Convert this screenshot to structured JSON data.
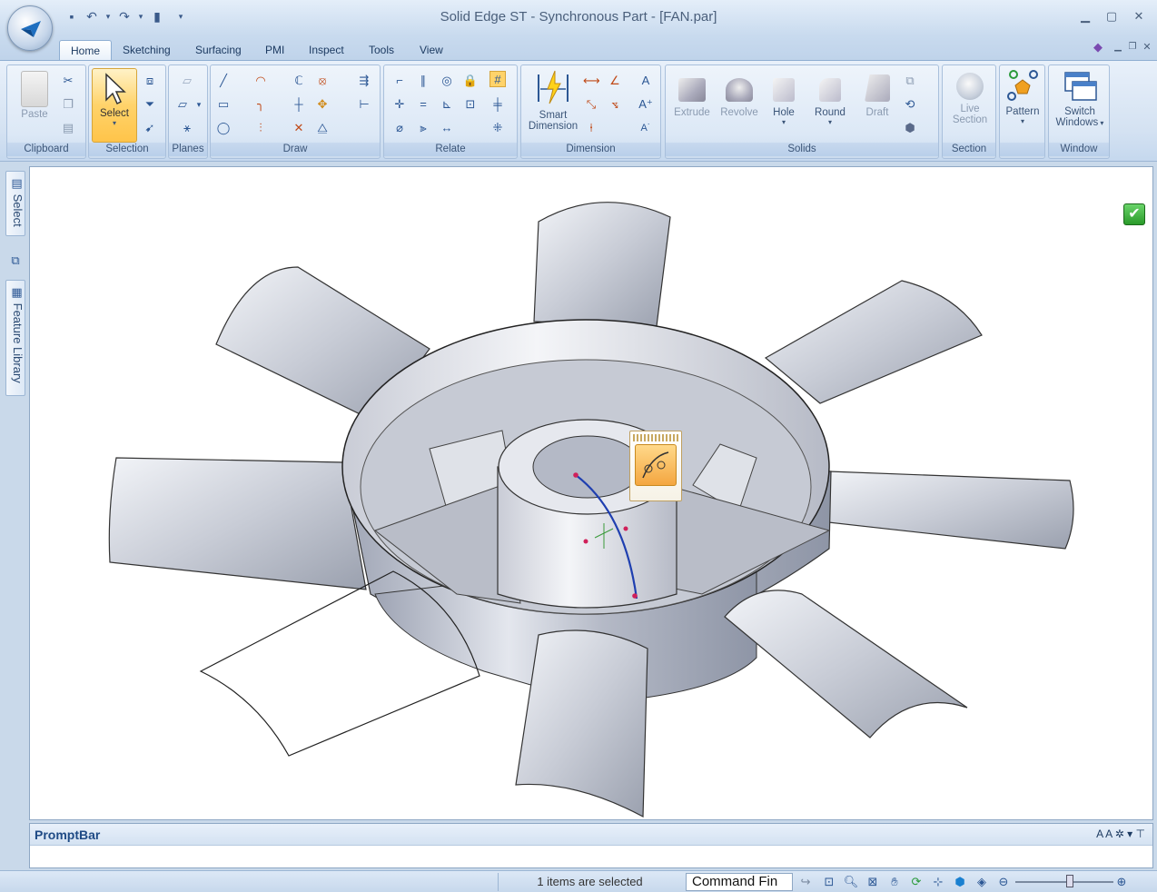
{
  "window": {
    "title": "Solid Edge ST - Synchronous Part - [FAN.par]"
  },
  "tabs": [
    "Home",
    "Sketching",
    "Surfacing",
    "PMI",
    "Inspect",
    "Tools",
    "View"
  ],
  "groups": {
    "clipboard": {
      "label": "Clipboard",
      "paste": "Paste"
    },
    "selection": {
      "label": "Selection",
      "select": "Select"
    },
    "planes": {
      "label": "Planes"
    },
    "draw": {
      "label": "Draw"
    },
    "relate": {
      "label": "Relate"
    },
    "dimension": {
      "label": "Dimension",
      "smart_line1": "Smart",
      "smart_line2": "Dimension"
    },
    "solids": {
      "label": "Solids",
      "extrude": "Extrude",
      "revolve": "Revolve",
      "hole": "Hole",
      "round": "Round",
      "draft": "Draft"
    },
    "section": {
      "label": "Section",
      "live_line1": "Live",
      "live_line2": "Section"
    },
    "pattern": {
      "label": "Pattern"
    },
    "window": {
      "label": "Window",
      "switch_line1": "Switch",
      "switch_line2": "Windows"
    }
  },
  "side_tabs": {
    "select": "Select",
    "feature_library": "Feature Library"
  },
  "promptbar": {
    "title": "PromptBar"
  },
  "status": {
    "selection": "1 items are selected",
    "command_finder": "Command Fin"
  },
  "colors": {
    "accent": "#ffc44a",
    "brand": "#1e4a85",
    "curve": "#1f3fb0",
    "point": "#d0205a"
  }
}
